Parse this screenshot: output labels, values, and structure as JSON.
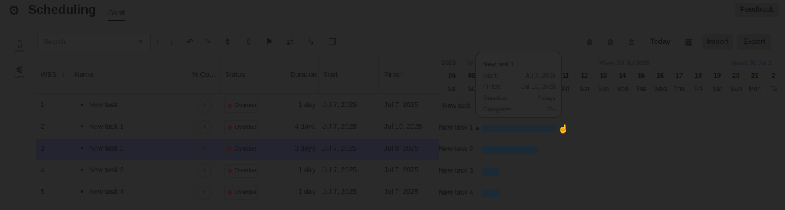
{
  "app": {
    "title": "Scheduling",
    "active_tab": "Gantt",
    "feedback_label": "Feedback"
  },
  "rail": [
    {
      "icon": "filter-icon",
      "glyph": "⩇",
      "label": "Filters"
    },
    {
      "icon": "sliders-icon",
      "glyph": "⚟",
      "label": "Fields"
    }
  ],
  "toolbar": {
    "search_placeholder": "Search",
    "today_label": "Today",
    "import_label": "Import",
    "export_label": "Export"
  },
  "columns": {
    "wbs": "WBS",
    "name": "Name",
    "complete": "% Co…",
    "status": "Status",
    "duration": "Duration",
    "start": "Start",
    "finish": "Finish"
  },
  "rows": [
    {
      "wbs": "1",
      "name": "New task",
      "complete": "0",
      "status": "Overdue",
      "duration": "1 day",
      "start": "Jul 7, 2025",
      "finish": "Jul 7, 2025"
    },
    {
      "wbs": "2",
      "name": "New task 1",
      "complete": "0",
      "status": "Overdue",
      "duration": "4 days",
      "start": "Jul 7, 2025",
      "finish": "Jul 10, 2025"
    },
    {
      "wbs": "3",
      "name": "New task 2",
      "complete": "0",
      "status": "Overdue",
      "duration": "3 days",
      "start": "Jul 7, 2025",
      "finish": "Jul 9, 2025"
    },
    {
      "wbs": "4",
      "name": "New task 3",
      "complete": "0",
      "status": "Overdue",
      "duration": "1 day",
      "start": "Jul 7, 2025",
      "finish": "Jul 7, 2025"
    },
    {
      "wbs": "5",
      "name": "New task 4",
      "complete": "0",
      "status": "Overdue",
      "duration": "1 day",
      "start": "Jul 7, 2025",
      "finish": "Jul 7, 2025"
    }
  ],
  "timeline": {
    "top_labels": [
      "2025",
      "W",
      "Week 29 Jul 2025",
      "Week 30 Jul 2"
    ],
    "days": [
      "05",
      "06",
      "11",
      "12",
      "13",
      "14",
      "15",
      "16",
      "17",
      "18",
      "19",
      "20",
      "21",
      "2"
    ],
    "weekdays": [
      "Sat",
      "Su",
      "Fri",
      "Sat",
      "Sun",
      "Mon",
      "Tue",
      "Wed",
      "Thu",
      "Fri",
      "Sat",
      "Sun",
      "Mon",
      "Tu"
    ]
  },
  "tooltip": {
    "title": "New task 1",
    "start_label": "Start:",
    "start": "Jul 7, 2025",
    "finish_label": "Finish:",
    "finish": "Jul 10, 2025",
    "duration_label": "Duration:",
    "duration": "4 days",
    "complete_label": "Complete:",
    "complete": "0%"
  },
  "colors": {
    "overlay_bg": "#2a2a2a",
    "bar": "#1c2a35",
    "overdue_dot": "#3a1818",
    "week_label": "#1b1b2b"
  }
}
